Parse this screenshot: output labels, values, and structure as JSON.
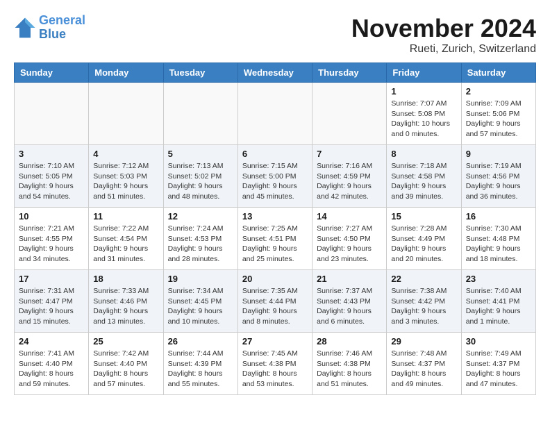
{
  "header": {
    "logo_line1": "General",
    "logo_line2": "Blue",
    "month_year": "November 2024",
    "location": "Rueti, Zurich, Switzerland"
  },
  "weekdays": [
    "Sunday",
    "Monday",
    "Tuesday",
    "Wednesday",
    "Thursday",
    "Friday",
    "Saturday"
  ],
  "weeks": [
    [
      {
        "day": "",
        "info": ""
      },
      {
        "day": "",
        "info": ""
      },
      {
        "day": "",
        "info": ""
      },
      {
        "day": "",
        "info": ""
      },
      {
        "day": "",
        "info": ""
      },
      {
        "day": "1",
        "info": "Sunrise: 7:07 AM\nSunset: 5:08 PM\nDaylight: 10 hours and 0 minutes."
      },
      {
        "day": "2",
        "info": "Sunrise: 7:09 AM\nSunset: 5:06 PM\nDaylight: 9 hours and 57 minutes."
      }
    ],
    [
      {
        "day": "3",
        "info": "Sunrise: 7:10 AM\nSunset: 5:05 PM\nDaylight: 9 hours and 54 minutes."
      },
      {
        "day": "4",
        "info": "Sunrise: 7:12 AM\nSunset: 5:03 PM\nDaylight: 9 hours and 51 minutes."
      },
      {
        "day": "5",
        "info": "Sunrise: 7:13 AM\nSunset: 5:02 PM\nDaylight: 9 hours and 48 minutes."
      },
      {
        "day": "6",
        "info": "Sunrise: 7:15 AM\nSunset: 5:00 PM\nDaylight: 9 hours and 45 minutes."
      },
      {
        "day": "7",
        "info": "Sunrise: 7:16 AM\nSunset: 4:59 PM\nDaylight: 9 hours and 42 minutes."
      },
      {
        "day": "8",
        "info": "Sunrise: 7:18 AM\nSunset: 4:58 PM\nDaylight: 9 hours and 39 minutes."
      },
      {
        "day": "9",
        "info": "Sunrise: 7:19 AM\nSunset: 4:56 PM\nDaylight: 9 hours and 36 minutes."
      }
    ],
    [
      {
        "day": "10",
        "info": "Sunrise: 7:21 AM\nSunset: 4:55 PM\nDaylight: 9 hours and 34 minutes."
      },
      {
        "day": "11",
        "info": "Sunrise: 7:22 AM\nSunset: 4:54 PM\nDaylight: 9 hours and 31 minutes."
      },
      {
        "day": "12",
        "info": "Sunrise: 7:24 AM\nSunset: 4:53 PM\nDaylight: 9 hours and 28 minutes."
      },
      {
        "day": "13",
        "info": "Sunrise: 7:25 AM\nSunset: 4:51 PM\nDaylight: 9 hours and 25 minutes."
      },
      {
        "day": "14",
        "info": "Sunrise: 7:27 AM\nSunset: 4:50 PM\nDaylight: 9 hours and 23 minutes."
      },
      {
        "day": "15",
        "info": "Sunrise: 7:28 AM\nSunset: 4:49 PM\nDaylight: 9 hours and 20 minutes."
      },
      {
        "day": "16",
        "info": "Sunrise: 7:30 AM\nSunset: 4:48 PM\nDaylight: 9 hours and 18 minutes."
      }
    ],
    [
      {
        "day": "17",
        "info": "Sunrise: 7:31 AM\nSunset: 4:47 PM\nDaylight: 9 hours and 15 minutes."
      },
      {
        "day": "18",
        "info": "Sunrise: 7:33 AM\nSunset: 4:46 PM\nDaylight: 9 hours and 13 minutes."
      },
      {
        "day": "19",
        "info": "Sunrise: 7:34 AM\nSunset: 4:45 PM\nDaylight: 9 hours and 10 minutes."
      },
      {
        "day": "20",
        "info": "Sunrise: 7:35 AM\nSunset: 4:44 PM\nDaylight: 9 hours and 8 minutes."
      },
      {
        "day": "21",
        "info": "Sunrise: 7:37 AM\nSunset: 4:43 PM\nDaylight: 9 hours and 6 minutes."
      },
      {
        "day": "22",
        "info": "Sunrise: 7:38 AM\nSunset: 4:42 PM\nDaylight: 9 hours and 3 minutes."
      },
      {
        "day": "23",
        "info": "Sunrise: 7:40 AM\nSunset: 4:41 PM\nDaylight: 9 hours and 1 minute."
      }
    ],
    [
      {
        "day": "24",
        "info": "Sunrise: 7:41 AM\nSunset: 4:40 PM\nDaylight: 8 hours and 59 minutes."
      },
      {
        "day": "25",
        "info": "Sunrise: 7:42 AM\nSunset: 4:40 PM\nDaylight: 8 hours and 57 minutes."
      },
      {
        "day": "26",
        "info": "Sunrise: 7:44 AM\nSunset: 4:39 PM\nDaylight: 8 hours and 55 minutes."
      },
      {
        "day": "27",
        "info": "Sunrise: 7:45 AM\nSunset: 4:38 PM\nDaylight: 8 hours and 53 minutes."
      },
      {
        "day": "28",
        "info": "Sunrise: 7:46 AM\nSunset: 4:38 PM\nDaylight: 8 hours and 51 minutes."
      },
      {
        "day": "29",
        "info": "Sunrise: 7:48 AM\nSunset: 4:37 PM\nDaylight: 8 hours and 49 minutes."
      },
      {
        "day": "30",
        "info": "Sunrise: 7:49 AM\nSunset: 4:37 PM\nDaylight: 8 hours and 47 minutes."
      }
    ]
  ]
}
